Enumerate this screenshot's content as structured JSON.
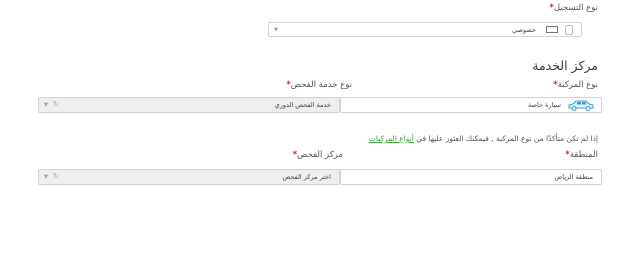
{
  "registration": {
    "label": "نوع التسجيل",
    "value": "خصوصي"
  },
  "service_center": {
    "title": "مركز الخدمة",
    "vehicle_type": {
      "label": "نوع المركبة",
      "value": "سيارة خاصة",
      "icon": "car-icon"
    },
    "inspection_service": {
      "label": "نوع خدمة الفحص",
      "value": "خدمة الفحص الدوري"
    },
    "note": {
      "text": "إذا لم تكن متأكدًا من نوع المركبة , فيمكنك العثور عليها في",
      "link": "أنواع المركبات"
    },
    "region": {
      "label": "المنطقة",
      "value": "منطقة الرياض"
    },
    "inspection_center": {
      "label": "مركز الفحص",
      "placeholder": "اختر مركز الفحص"
    }
  },
  "colors": {
    "required": "#d9262a",
    "link": "#3aa23a",
    "field_border": "#d3d3d3",
    "disabled_field": "#eeeeee",
    "car_icon": "#3b9bd1"
  }
}
